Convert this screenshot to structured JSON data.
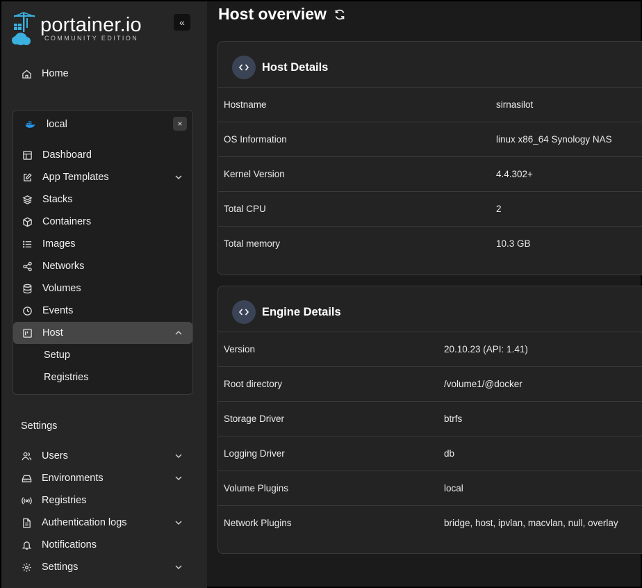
{
  "brand": {
    "name": "portainer.io",
    "edition": "COMMUNITY EDITION",
    "accent": "#3bb1e0"
  },
  "sidebar": {
    "collapse_label": "«",
    "home": "Home",
    "environment": {
      "name": "local",
      "close": "×"
    },
    "env_items": [
      {
        "label": "Dashboard",
        "icon": "dashboard-icon"
      },
      {
        "label": "App Templates",
        "icon": "edit-icon",
        "expandable": true
      },
      {
        "label": "Stacks",
        "icon": "layers-icon"
      },
      {
        "label": "Containers",
        "icon": "box-icon"
      },
      {
        "label": "Images",
        "icon": "list-icon"
      },
      {
        "label": "Networks",
        "icon": "share-icon"
      },
      {
        "label": "Volumes",
        "icon": "database-icon"
      },
      {
        "label": "Events",
        "icon": "clock-icon"
      },
      {
        "label": "Host",
        "icon": "host-icon",
        "expanded": true,
        "active": true
      }
    ],
    "host_sub": [
      "Setup",
      "Registries"
    ],
    "settings_title": "Settings",
    "settings_items": [
      {
        "label": "Users",
        "icon": "users-icon",
        "expandable": true
      },
      {
        "label": "Environments",
        "icon": "hdd-icon",
        "expandable": true
      },
      {
        "label": "Registries",
        "icon": "radio-icon"
      },
      {
        "label": "Authentication logs",
        "icon": "file-icon",
        "expandable": true
      },
      {
        "label": "Notifications",
        "icon": "bell-icon"
      },
      {
        "label": "Settings",
        "icon": "gear-icon",
        "expandable": true
      }
    ]
  },
  "main": {
    "title": "Host overview",
    "host_details": {
      "title": "Host Details",
      "rows": [
        {
          "key": "Hostname",
          "value": "sirnasilot"
        },
        {
          "key": "OS Information",
          "value": "linux x86_64 Synology NAS"
        },
        {
          "key": "Kernel Version",
          "value": "4.4.302+"
        },
        {
          "key": "Total CPU",
          "value": "2"
        },
        {
          "key": "Total memory",
          "value": "10.3 GB"
        }
      ]
    },
    "engine_details": {
      "title": "Engine Details",
      "rows": [
        {
          "key": "Version",
          "value": "20.10.23 (API: 1.41)"
        },
        {
          "key": "Root directory",
          "value": "/volume1/@docker"
        },
        {
          "key": "Storage Driver",
          "value": "btrfs"
        },
        {
          "key": "Logging Driver",
          "value": "db"
        },
        {
          "key": "Volume Plugins",
          "value": "local"
        },
        {
          "key": "Network Plugins",
          "value": "bridge, host, ipvlan, macvlan, null, overlay"
        }
      ]
    }
  }
}
